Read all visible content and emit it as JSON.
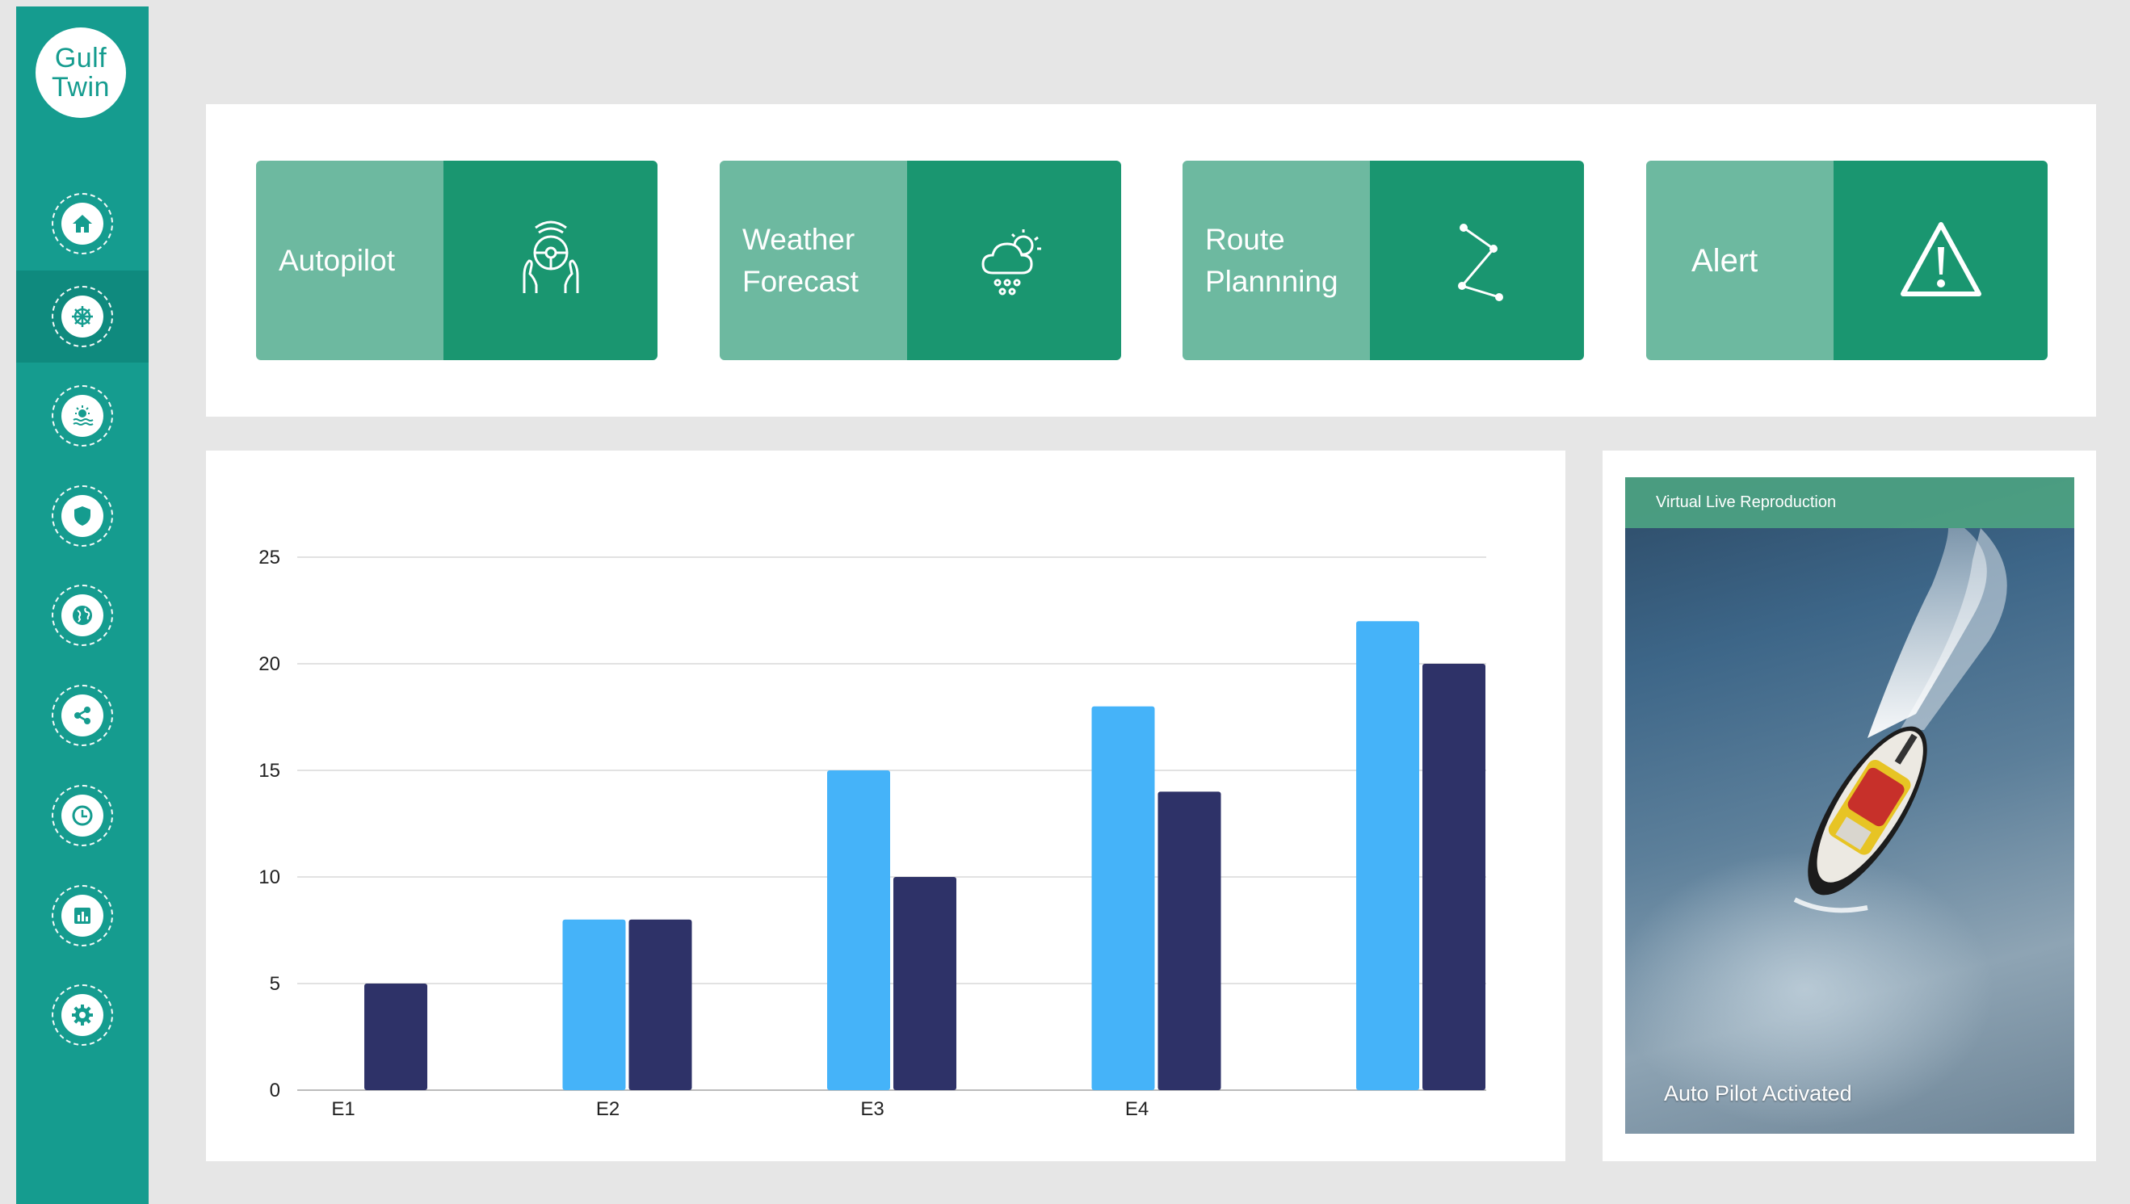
{
  "app": {
    "logo_line1": "Gulf",
    "logo_line2": "Twin",
    "brand_color": "#159c8f"
  },
  "sidebar": {
    "items": [
      {
        "icon": "home-icon",
        "active": false
      },
      {
        "icon": "ship-wheel-icon",
        "active": true
      },
      {
        "icon": "sun-over-water-icon",
        "active": false
      },
      {
        "icon": "shield-icon",
        "active": false
      },
      {
        "icon": "globe-icon",
        "active": false
      },
      {
        "icon": "share-icon",
        "active": false
      },
      {
        "icon": "clock-icon",
        "active": false
      },
      {
        "icon": "bar-chart-icon",
        "active": false
      },
      {
        "icon": "gear-icon",
        "active": false
      }
    ]
  },
  "tiles": [
    {
      "label": "Autopilot",
      "icon": "hands-steering-wheel-icon"
    },
    {
      "label_line1": "Weather",
      "label_line2": "Forecast",
      "icon": "cloud-rain-sun-icon"
    },
    {
      "label_line1": "Route",
      "label_line2": "Plannning",
      "icon": "route-path-icon"
    },
    {
      "label": "Alert",
      "icon": "warning-triangle-icon"
    }
  ],
  "colors": {
    "tile_light": "#6db9a0",
    "tile_dark": "#1a9670",
    "series_light": "#45b3f9",
    "series_dark": "#2e3268"
  },
  "chart_data": {
    "type": "bar",
    "categories": [
      "E1",
      "E2",
      "E3",
      "E4",
      ""
    ],
    "series": [
      {
        "values": [
          0,
          8,
          15,
          18,
          22
        ],
        "color": "#45b3f9"
      },
      {
        "values": [
          5,
          8,
          10,
          14,
          20
        ],
        "color": "#2e3268"
      }
    ],
    "yticks": [
      "0",
      "5",
      "10",
      "15",
      "20",
      "25"
    ],
    "ylim": [
      0,
      25
    ],
    "grid": true,
    "title": "",
    "xlabel": "",
    "ylabel": ""
  },
  "video": {
    "header": "Virtual Live Reproduction",
    "caption": "Auto Pilot Activated"
  }
}
